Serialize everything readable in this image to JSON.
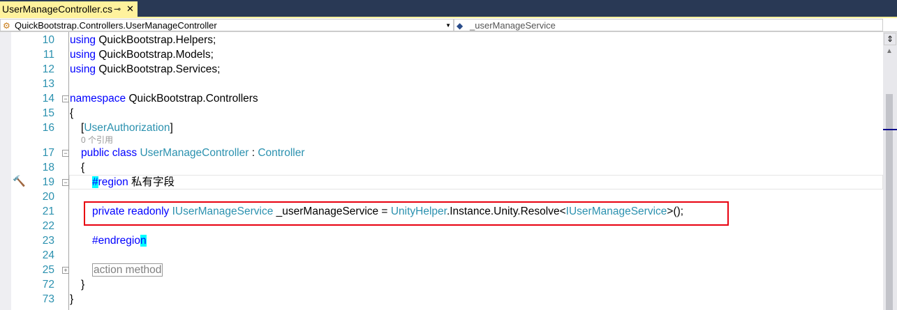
{
  "tab": {
    "title": "UserManageController.cs",
    "pin": "⊸",
    "close": "✕"
  },
  "nav": {
    "type_dropdown": "QuickBootstrap.Controllers.UserManageController",
    "member_dropdown": "_userManageService"
  },
  "lines": [
    {
      "n": "10",
      "indent": 0,
      "parts": [
        [
          "kw",
          "using"
        ],
        [
          "",
          "QuickBootstrap.Helpers;"
        ]
      ]
    },
    {
      "n": "11",
      "indent": 0,
      "parts": [
        [
          "kw",
          "using"
        ],
        [
          "",
          "QuickBootstrap.Models;"
        ]
      ]
    },
    {
      "n": "12",
      "indent": 0,
      "parts": [
        [
          "kw",
          "using"
        ],
        [
          "",
          "QuickBootstrap.Services;"
        ]
      ]
    },
    {
      "n": "13",
      "indent": 0,
      "parts": []
    },
    {
      "n": "14",
      "indent": 0,
      "fold": "-",
      "parts": [
        [
          "kw",
          "namespace"
        ],
        [
          "",
          "QuickBootstrap.Controllers"
        ]
      ]
    },
    {
      "n": "15",
      "indent": 0,
      "parts": [
        [
          "",
          "{"
        ]
      ]
    },
    {
      "n": "16",
      "indent": 1,
      "parts": [
        [
          "",
          "["
        ],
        [
          "ty",
          "UserAuthorization"
        ],
        [
          "",
          "]"
        ]
      ]
    },
    {
      "n": "",
      "indent": 1,
      "codelens": "0 个引用"
    },
    {
      "n": "17",
      "indent": 1,
      "fold": "-",
      "parts": [
        [
          "kw",
          "public class"
        ],
        [
          "ty",
          "UserManageController"
        ],
        [
          "",
          ":"
        ],
        [
          "ty",
          "Controller"
        ]
      ]
    },
    {
      "n": "18",
      "indent": 1,
      "parts": [
        [
          "",
          "{"
        ]
      ]
    },
    {
      "n": "19",
      "indent": 2,
      "fold": "-",
      "current": true,
      "parts": [
        [
          "kw hl",
          "#"
        ],
        [
          "kw",
          "region"
        ],
        [
          "",
          "私有字段"
        ]
      ]
    },
    {
      "n": "20",
      "indent": 2,
      "parts": []
    },
    {
      "n": "21",
      "indent": 2,
      "parts": [
        [
          "kw",
          "private readonly"
        ],
        [
          "ty",
          "IUserManageService"
        ],
        [
          "",
          "_userManageService ="
        ],
        [
          "ty",
          "UnityHelper"
        ],
        [
          "",
          ".Instance.Unity.Resolve<"
        ],
        [
          "ty",
          "IUserManageService"
        ],
        [
          "",
          ">();"
        ]
      ]
    },
    {
      "n": "22",
      "indent": 2,
      "parts": []
    },
    {
      "n": "23",
      "indent": 2,
      "parts": [
        [
          "kw",
          "#endregio"
        ],
        [
          "kw hl",
          "n"
        ]
      ]
    },
    {
      "n": "24",
      "indent": 2,
      "parts": []
    },
    {
      "n": "25",
      "indent": 2,
      "fold": "+",
      "parts": [
        [
          "collapsed",
          "action method"
        ]
      ]
    },
    {
      "n": "72",
      "indent": 1,
      "parts": [
        [
          "",
          "}"
        ]
      ]
    },
    {
      "n": "73",
      "indent": 0,
      "parts": [
        [
          "",
          "}"
        ]
      ]
    }
  ]
}
